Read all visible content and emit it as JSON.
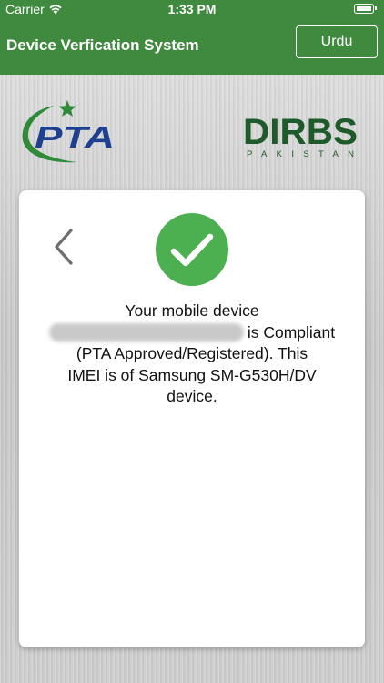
{
  "status_bar": {
    "carrier": "Carrier",
    "time": "1:33 PM"
  },
  "nav": {
    "title": "Device Verfication System",
    "language_button": "Urdu"
  },
  "logos": {
    "left": "PTA",
    "right_main": "DIRBS",
    "right_sub": "PAKISTAN"
  },
  "result": {
    "line1": "Your mobile device",
    "line2_suffix": "is Compliant",
    "line3": "(PTA Approved/Registered). This",
    "line4": "IMEI is of Samsung SM-G530H/DV",
    "line5": "device."
  },
  "colors": {
    "header_green": "#3f8a3f",
    "check_green": "#4caf50",
    "pta_blue": "#1f3f8f",
    "pta_green": "#2f8a3a",
    "dirbs_green": "#1f5a2a"
  },
  "icons": {
    "back": "chevron-left-icon",
    "success": "check-circle-icon",
    "wifi": "wifi-icon",
    "battery": "battery-icon"
  }
}
